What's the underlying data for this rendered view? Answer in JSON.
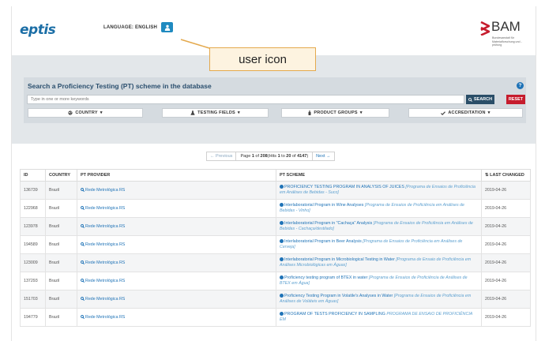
{
  "header": {
    "logo": "eptis",
    "language_label": "LANGUAGE: ENGLISH",
    "user_icon": "user-icon",
    "bam": {
      "name": "BAM",
      "subtitle": "Bundesanstalt für Materialforschung und -prüfung"
    }
  },
  "annotation": {
    "label": "user icon"
  },
  "search": {
    "title": "Search a Proficiency Testing (PT) scheme in the database",
    "placeholder": "Type in one or more keywords",
    "search_label": "SEARCH",
    "reset_label": "RESET",
    "filters": [
      {
        "label": "COUNTRY",
        "icon": "globe-icon"
      },
      {
        "label": "TESTING FIELDS",
        "icon": "flask-icon"
      },
      {
        "label": "PRODUCT GROUPS",
        "icon": "bottle-icon"
      },
      {
        "label": "ACCREDITATION",
        "icon": "check-icon"
      }
    ]
  },
  "pagination": {
    "prev": "← Previous",
    "info_prefix": "Page ",
    "page": "1",
    "of": " of ",
    "total_pages": "208",
    "hits_prefix": " (Hits ",
    "from": "1",
    "to_word": " to ",
    "to": "20",
    "of2": " of ",
    "total_hits": "4147",
    "hits_suffix": ")",
    "next": "Next →"
  },
  "table": {
    "columns": {
      "id": "ID",
      "country": "COUNTRY",
      "provider": "PT PROVIDER",
      "scheme": "PT SCHEME",
      "changed": "LAST CHANGED"
    },
    "rows": [
      {
        "id": "136739",
        "country": "Brazil",
        "provider": "Rede Metrológica RS",
        "scheme": "PROFICIENCY TESTING PROGRAM IN ANALYSIS OF JUICES",
        "scheme_sub": "[Programa de Ensaios de Proficiência em Análises de Bebidas - Suco]",
        "date": "2019-04-26"
      },
      {
        "id": "122968",
        "country": "Brazil",
        "provider": "Rede Metrológica RS",
        "scheme": "Interlaboratorial Program in Wine Analyses",
        "scheme_sub": "[Programa de Ensaios de Proficiência em Análises de Bebidas - Vinho]",
        "date": "2019-04-26"
      },
      {
        "id": "123978",
        "country": "Brazil",
        "provider": "Rede Metrológica RS",
        "scheme": "Interlaboratorial Program in \"Cachaça\" Analysis",
        "scheme_sub": "[Programa de Ensaios de Proficiência em Análises de Bebidas - Cachaça/destilado]",
        "date": "2019-04-26"
      },
      {
        "id": "194589",
        "country": "Brazil",
        "provider": "Rede Metrológica RS",
        "scheme": "Interlaboratorial Program in Beer Analysis",
        "scheme_sub": "[Programa de Ensaios de Proficiência em Análises de Cerveja]",
        "date": "2019-04-26"
      },
      {
        "id": "123009",
        "country": "Brazil",
        "provider": "Rede Metrológica RS",
        "scheme": "Interlaboratorial Program in Microbiological Testing in Water",
        "scheme_sub": "[Programa de Ensaio de Proficiência em Análises Microbiológicas em Águas]",
        "date": "2019-04-26"
      },
      {
        "id": "137293",
        "country": "Brazil",
        "provider": "Rede Metrológica RS",
        "scheme": "Proficiency testing program of BTEX in water",
        "scheme_sub": "[Programa de Ensaios de Proficiência de Análises de BTEX em Água]",
        "date": "2019-04-26"
      },
      {
        "id": "151703",
        "country": "Brazil",
        "provider": "Rede Metrológica RS",
        "scheme": "Proficiency Testing Program in Volatile's Analyses in Water",
        "scheme_sub": "[Programa de Ensaios de Proficiência em Análises de Voláteis em Águas]",
        "date": "2019-04-26"
      },
      {
        "id": "194779",
        "country": "Brazil",
        "provider": "Rede Metrológica RS",
        "scheme": "PROGRAM OF TESTS PROFICIENCY IN SAMPLING",
        "scheme_sub": "PROGRAMA DE ENSAIO DE PROFICIÊNCIA EM",
        "date": "2019-04-26"
      }
    ]
  }
}
